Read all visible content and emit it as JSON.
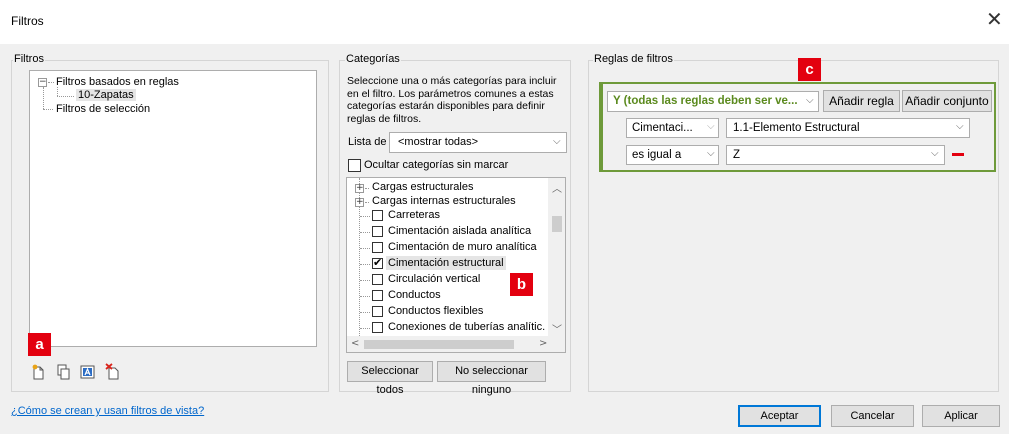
{
  "window": {
    "title": "Filtros",
    "close_icon": "close-icon"
  },
  "filters_panel": {
    "label": "Filtros",
    "tree": {
      "rule_based": "Filtros basados en reglas",
      "rule_child": "10-Zapatas",
      "selection": "Filtros de selección"
    },
    "callout": "a",
    "toolbar_icons": [
      "new-filter-icon",
      "duplicate-icon",
      "rename-icon",
      "delete-icon"
    ]
  },
  "categories_panel": {
    "label": "Categorías",
    "description": "Seleccione una o más categorías para incluir en el filtro. Los parámetros comunes a estas categorías estarán disponibles para definir reglas de filtros.",
    "list_label": "Lista de",
    "list_value": "<mostrar todas>",
    "hide_unchecked": "Ocultar categorías sin marcar",
    "items": [
      "Cargas estructurales",
      "Cargas internas estructurales",
      "Carreteras",
      "Cimentación aislada analítica",
      "Cimentación de muro analítica",
      "Cimentación estructural",
      "Circulación vertical",
      "Conductos",
      "Conductos flexibles",
      "Conexiones de tuberías analític..."
    ],
    "checked_item": "Cimentación estructural",
    "callout": "b",
    "select_all": "Seleccionar todos",
    "select_none": "No seleccionar ninguno"
  },
  "rules_panel": {
    "label": "Reglas de filtros",
    "callout": "c",
    "condition": "Y (todas las reglas deben ser ve...",
    "add_rule": "Añadir regla",
    "add_set": "Añadir conjunto",
    "rule_category": "Cimentaci...",
    "rule_parameter": "1.1-Elemento Estructural",
    "rule_operator": "es igual a",
    "rule_value": "Z",
    "accent_color": "#6e9a3a",
    "remove_color": "#e3000f"
  },
  "footer": {
    "help_link": "¿Cómo se crean y usan filtros de vista?",
    "ok": "Aceptar",
    "cancel": "Cancelar",
    "apply": "Aplicar"
  }
}
